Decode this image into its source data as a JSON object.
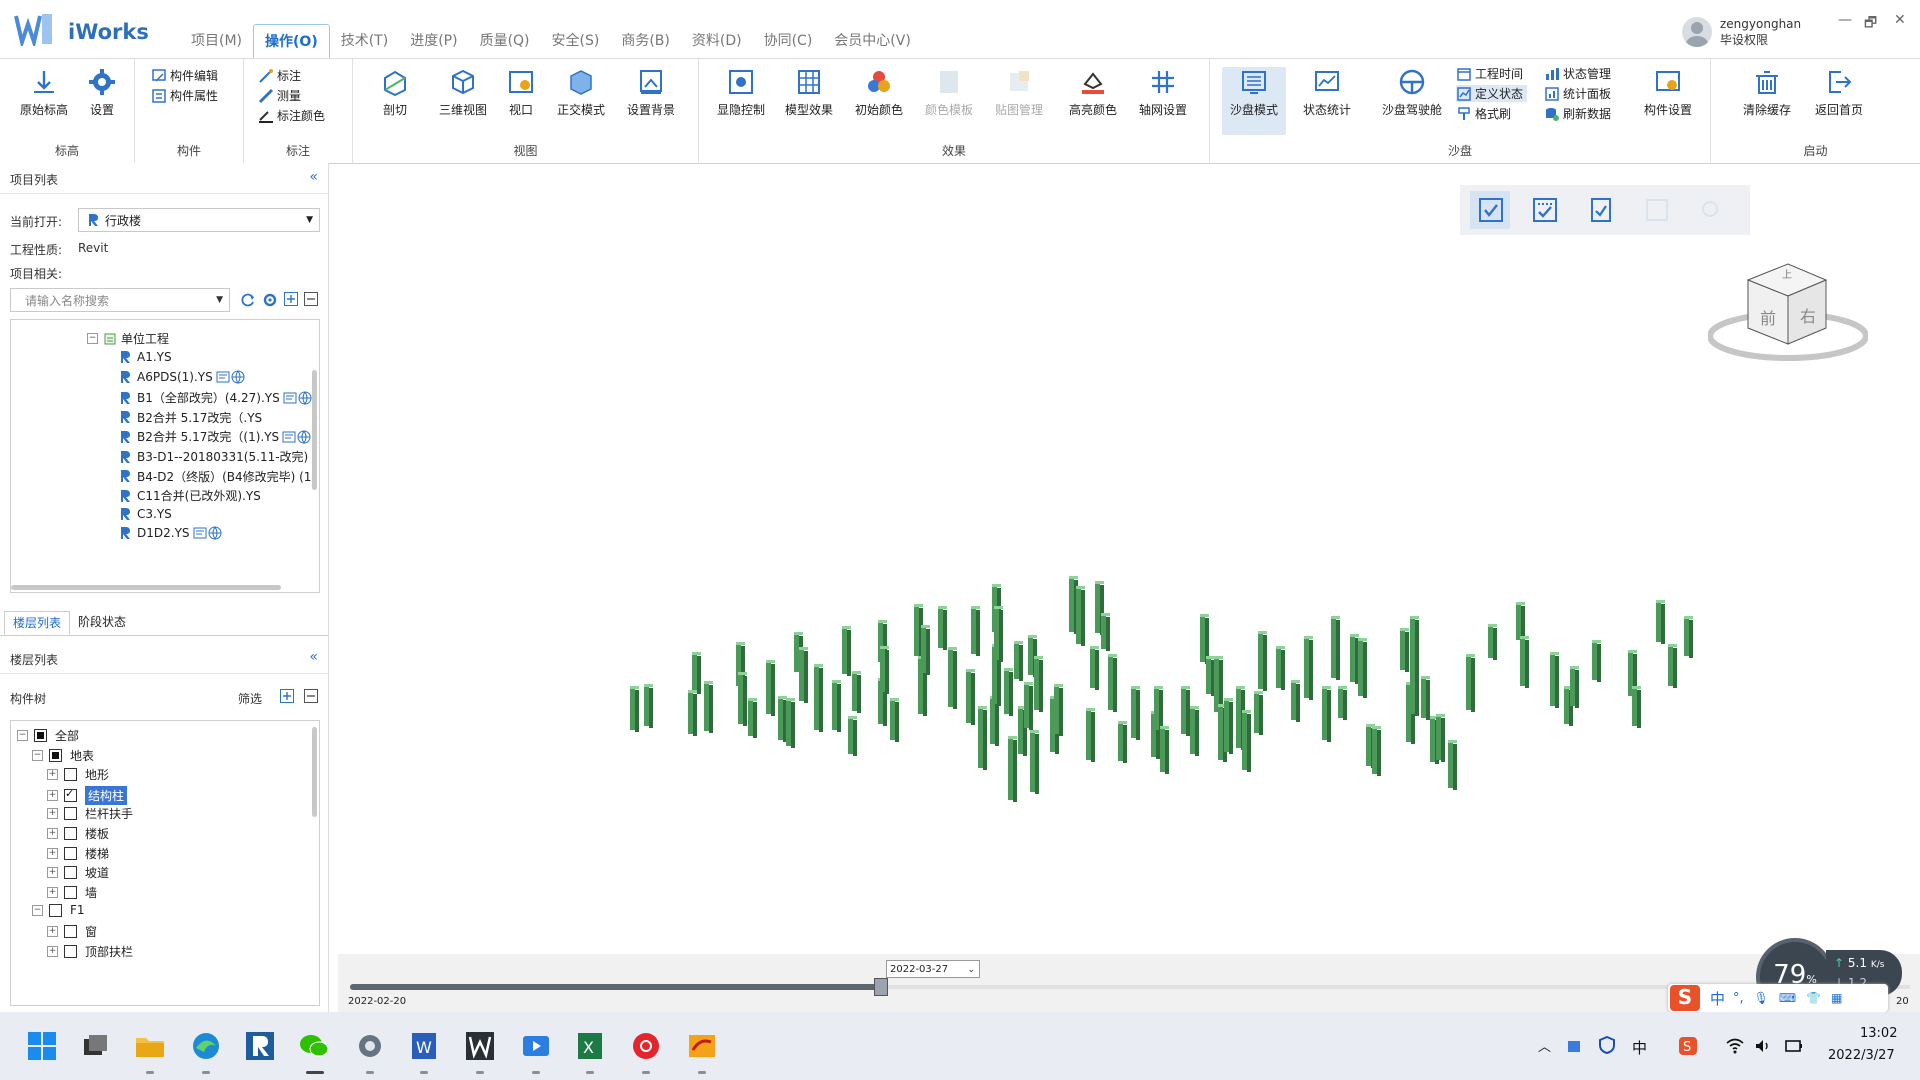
{
  "app": {
    "title": "iWorks"
  },
  "menu": [
    {
      "label": "项目(M)"
    },
    {
      "label": "操作(O)"
    },
    {
      "label": "技术(T)"
    },
    {
      "label": "进度(P)"
    },
    {
      "label": "质量(Q)"
    },
    {
      "label": "安全(S)"
    },
    {
      "label": "商务(B)"
    },
    {
      "label": "资料(D)"
    },
    {
      "label": "协同(C)"
    },
    {
      "label": "会员中心(V)"
    }
  ],
  "active_menu": "操作(O)",
  "user": {
    "name": "zengyonghan",
    "role": "毕设权限"
  },
  "window_controls": {
    "minimize": "—",
    "restore": "🗗",
    "close": "✕"
  },
  "ribbon": {
    "groups": {
      "elevation": "标高",
      "component": "构件",
      "annotation": "标注",
      "view": "视图",
      "effect": "效果",
      "sandbox": "沙盘",
      "startup": "启动"
    },
    "buttons": {
      "original_elevation": "原始标高",
      "settings": "设置",
      "component_edit": "构件编辑",
      "component_attr": "构件属性",
      "annotate": "标注",
      "measure": "测量",
      "annotate_color": "标注颜色",
      "section": "剖切",
      "view3d": "三维视图",
      "viewport": "视口",
      "ortho": "正交模式",
      "set_bg": "设置背景",
      "show_hide": "显隐控制",
      "model_effect": "模型效果",
      "init_color": "初始颜色",
      "color_board": "颜色模板",
      "texture_mgmt": "贴图管理",
      "highlight_color": "高亮颜色",
      "axis_settings": "轴网设置",
      "sandbox_mode": "沙盘模式",
      "status_stats": "状态统计",
      "sandbox_drive": "沙盘驾驶舱",
      "project_time": "工程时间",
      "define_status": "定义状态",
      "format_brush": "格式刷",
      "status_mgmt": "状态管理",
      "stats_panel": "统计面板",
      "refresh_data": "刷新数据",
      "component_settings": "构件设置",
      "clear_cache": "清除缓存",
      "back_home": "返回首页"
    }
  },
  "project_panel": {
    "title": "项目列表",
    "collapse": "«",
    "current_open_label": "当前打开:",
    "current_open_value": "行政楼",
    "nature_label": "工程性质:",
    "nature_value": "Revit",
    "related_label": "项目相关:",
    "search_placeholder": "请输入名称搜索",
    "tree_root": "单位工程",
    "items": [
      {
        "label": "A1.YS",
        "badges": false
      },
      {
        "label": "A6PDS(1).YS",
        "badges": true
      },
      {
        "label": "B1（全部改完）(4.27).YS",
        "badges": true
      },
      {
        "label": "B2合并  5.17改完（.YS",
        "badges": false
      },
      {
        "label": "B2合并  5.17改完（(1).YS",
        "badges": true
      },
      {
        "label": "B3-D1--20180331(5.11-改完)",
        "badges": false
      },
      {
        "label": "B4-D2（终版）(B4修改完毕) (1",
        "badges": false
      },
      {
        "label": "C11合并(已改外观).YS",
        "badges": false
      },
      {
        "label": "C3.YS",
        "badges": false
      },
      {
        "label": "D1D2.YS",
        "badges": true
      }
    ]
  },
  "lower_tabs": [
    {
      "label": "楼层列表"
    },
    {
      "label": "阶段状态"
    }
  ],
  "floor_panel": {
    "title": "楼层列表",
    "collapse": "«",
    "tree_label": "构件树",
    "filter": "筛选",
    "nodes": [
      {
        "label": "全部",
        "level": 0,
        "check": "full",
        "expand": "−"
      },
      {
        "label": "地表",
        "level": 1,
        "check": "full",
        "expand": "−"
      },
      {
        "label": "地形",
        "level": 2,
        "check": "none",
        "expand": "+"
      },
      {
        "label": "结构柱",
        "level": 2,
        "check": "tick",
        "expand": "+",
        "selected": true
      },
      {
        "label": "栏杆扶手",
        "level": 2,
        "check": "none",
        "expand": "+"
      },
      {
        "label": "楼板",
        "level": 2,
        "check": "none",
        "expand": "+"
      },
      {
        "label": "楼梯",
        "level": 2,
        "check": "none",
        "expand": "+"
      },
      {
        "label": "坡道",
        "level": 2,
        "check": "none",
        "expand": "+"
      },
      {
        "label": "墙",
        "level": 2,
        "check": "none",
        "expand": "+"
      },
      {
        "label": "F1",
        "level": 1,
        "check": "none",
        "expand": "−"
      },
      {
        "label": "窗",
        "level": 2,
        "check": "none",
        "expand": "+"
      },
      {
        "label": "顶部扶栏",
        "level": 2,
        "check": "none",
        "expand": "+"
      }
    ]
  },
  "viewcube": {
    "front": "前",
    "right": "右",
    "top": "上"
  },
  "timeline": {
    "start": "2022-02-20",
    "current": "2022-03-27",
    "end_partial": "20",
    "position": 0.34
  },
  "perf_widget": {
    "cpu": "79",
    "unit": "%",
    "upload": "5.1",
    "upload_unit": "K/s",
    "download": "1.2"
  },
  "ime": {
    "mode": "中",
    "punct": "°,"
  },
  "taskbar": {
    "clock_time": "13:02",
    "clock_date": "2022/3/27",
    "input_lang": "中"
  },
  "colors": {
    "accent": "#1e6cd0",
    "column_green": "#4c9a5a",
    "ribbon_active": "#dde8f5"
  }
}
